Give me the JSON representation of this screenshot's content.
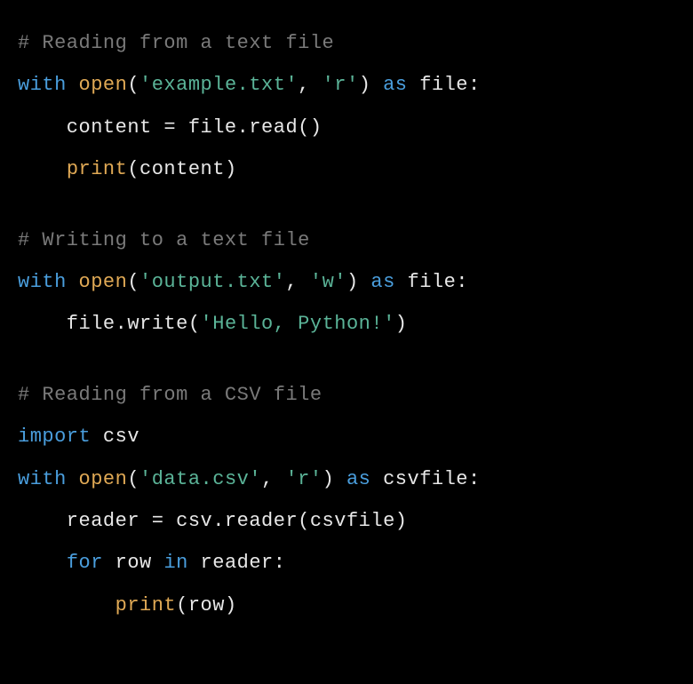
{
  "code": {
    "line1_comment": "# Reading from a text file",
    "line2_with": "with",
    "line2_open": "open",
    "line2_paren1": "(",
    "line2_str1": "'example.txt'",
    "line2_comma": ", ",
    "line2_str2": "'r'",
    "line2_paren2": ") ",
    "line2_as": "as",
    "line2_file": " file:",
    "line3_indent": "    content = file.read()",
    "line4_indent": "    ",
    "line4_print": "print",
    "line4_rest": "(content)",
    "line5_comment": "# Writing to a text file",
    "line6_with": "with",
    "line6_open": "open",
    "line6_paren1": "(",
    "line6_str1": "'output.txt'",
    "line6_comma": ", ",
    "line6_str2": "'w'",
    "line6_paren2": ") ",
    "line6_as": "as",
    "line6_file": " file:",
    "line7_indent": "    file.write(",
    "line7_str": "'Hello, Python!'",
    "line7_close": ")",
    "line8_comment": "# Reading from a CSV file",
    "line9_import": "import",
    "line9_csv": " csv",
    "line10_with": "with",
    "line10_open": "open",
    "line10_paren1": "(",
    "line10_str1": "'data.csv'",
    "line10_comma": ", ",
    "line10_str2": "'r'",
    "line10_paren2": ") ",
    "line10_as": "as",
    "line10_file": " csvfile:",
    "line11_indent": "    reader = csv.reader(csvfile)",
    "line12_indent": "    ",
    "line12_for": "for",
    "line12_row": " row ",
    "line12_in": "in",
    "line12_reader": " reader:",
    "line13_indent": "        ",
    "line13_print": "print",
    "line13_rest": "(row)"
  }
}
